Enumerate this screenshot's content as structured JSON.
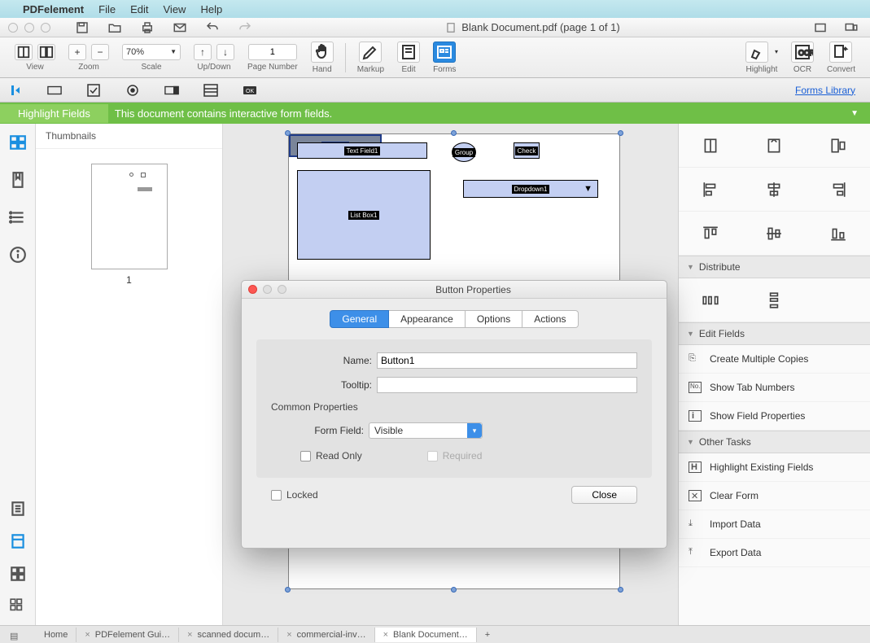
{
  "menubar": {
    "app": "PDFelement",
    "items": [
      "File",
      "Edit",
      "View",
      "Help"
    ]
  },
  "titlebar": {
    "title": "Blank Document.pdf (page 1 of 1)"
  },
  "toolbar": {
    "view_label": "View",
    "zoom_value": "70%",
    "zoom_label": "Zoom",
    "scale_label": "Scale",
    "updown_label": "Up/Down",
    "page_value": "1",
    "page_label": "Page Number",
    "hand_label": "Hand",
    "markup_label": "Markup",
    "edit_label": "Edit",
    "forms_label": "Forms",
    "highlight_label": "Highlight",
    "ocr_label": "OCR",
    "convert_label": "Convert"
  },
  "subtoolbar": {
    "forms_library": "Forms Library"
  },
  "banner": {
    "button": "Highlight Fields",
    "text": "This document contains interactive form fields."
  },
  "thumbnails": {
    "header": "Thumbnails",
    "page_number": "1"
  },
  "form_fields": {
    "text_field": "Text Field1",
    "list_box": "List Box1",
    "group": "Group",
    "check": "Check",
    "dropdown": "Dropdown1",
    "button": "Button1"
  },
  "right_panel": {
    "distribute": "Distribute",
    "edit_fields": "Edit Fields",
    "create_copies": "Create Multiple Copies",
    "show_tab": "Show Tab Numbers",
    "show_props": "Show Field Properties",
    "other_tasks": "Other Tasks",
    "highlight_existing": "Highlight Existing Fields",
    "clear_form": "Clear Form",
    "import_data": "Import Data",
    "export_data": "Export Data"
  },
  "dialog": {
    "title": "Button Properties",
    "tabs": {
      "general": "General",
      "appearance": "Appearance",
      "options": "Options",
      "actions": "Actions"
    },
    "name_label": "Name:",
    "name_value": "Button1",
    "tooltip_label": "Tooltip:",
    "tooltip_value": "",
    "common_props": "Common Properties",
    "form_field_label": "Form Field:",
    "form_field_value": "Visible",
    "read_only": "Read Only",
    "required": "Required",
    "locked": "Locked",
    "close": "Close"
  },
  "doctabs": {
    "home": "Home",
    "t1": "PDFelement Gui…",
    "t2": "scanned docum…",
    "t3": "commercial-inv…",
    "t4": "Blank Document…"
  }
}
